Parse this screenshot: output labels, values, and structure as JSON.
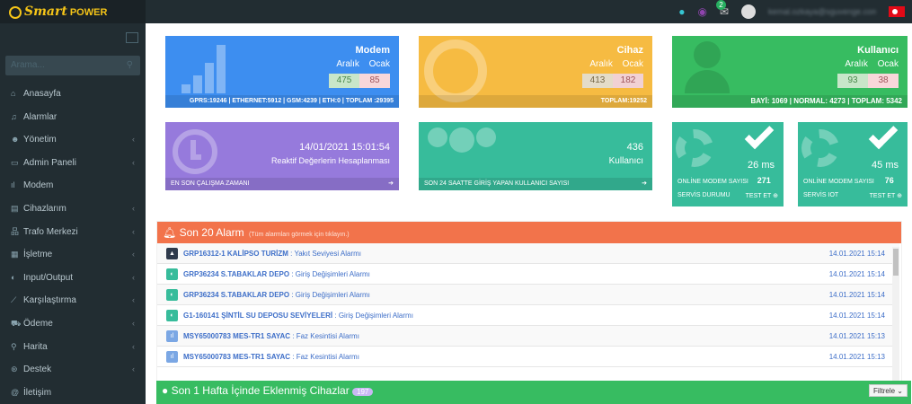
{
  "app": {
    "logo_main": "Smart",
    "logo_sub": "POWER"
  },
  "topbar": {
    "notif_count": "2",
    "user_email": "kemal.ozkaya@sguvenge.com"
  },
  "sidebar": {
    "search_placeholder": "Arama...",
    "items": [
      {
        "label": "Anasayfa",
        "icon": "home-icon",
        "has_children": false
      },
      {
        "label": "Alarmlar",
        "icon": "bell-icon",
        "has_children": false
      },
      {
        "label": "Yönetim",
        "icon": "users-icon",
        "has_children": true
      },
      {
        "label": "Admin Paneli",
        "icon": "monitor-icon",
        "has_children": true
      },
      {
        "label": "Modem",
        "icon": "signal-icon",
        "has_children": false
      },
      {
        "label": "Cihazlarım",
        "icon": "device-icon",
        "has_children": true
      },
      {
        "label": "Trafo Merkezi",
        "icon": "sitemap-icon",
        "has_children": true
      },
      {
        "label": "İşletme",
        "icon": "building-icon",
        "has_children": true
      },
      {
        "label": "Input/Output",
        "icon": "toggle-icon",
        "has_children": true
      },
      {
        "label": "Karşılaştırma",
        "icon": "chart-icon",
        "has_children": true
      },
      {
        "label": "Ödeme",
        "icon": "cart-icon",
        "has_children": true
      },
      {
        "label": "Harita",
        "icon": "map-pin-icon",
        "has_children": true
      },
      {
        "label": "Destek",
        "icon": "support-icon",
        "has_children": true
      },
      {
        "label": "İletişim",
        "icon": "contact-icon",
        "has_children": false
      }
    ]
  },
  "cards": {
    "modem": {
      "title": "Modem",
      "sub_a": "Aralık",
      "sub_b": "Ocak",
      "val_a": "475",
      "val_b": "85",
      "footer": "GPRS:19246 | ETHERNET:5912 | GSM:4239 | ETH:0 | TOPLAM :29395"
    },
    "cihaz": {
      "title": "Cihaz",
      "sub_a": "Aralık",
      "sub_b": "Ocak",
      "val_a": "413",
      "val_b": "182",
      "footer": "TOPLAM:19252"
    },
    "kullanici": {
      "title": "Kullanıcı",
      "sub_a": "Aralık",
      "sub_b": "Ocak",
      "val_a": "93",
      "val_b": "38",
      "footer": "BAYİ: 1069 | NORMAL: 4273 | TOPLAM: 5342"
    },
    "last_run": {
      "datetime": "14/01/2021 15:01:54",
      "desc": "Reaktif Değerlerin Hesaplanması",
      "footer": "EN SON ÇALIŞMA ZAMANI"
    },
    "users24": {
      "count": "436",
      "label": "Kullanıcı",
      "footer": "SON 24 SAATTE GİRİŞ YAPAN KULLANICI SAYISI"
    },
    "service1": {
      "ms": "26 ms",
      "online_label": "ONLİNE MODEM SAYISI",
      "online_val": "271",
      "footer_left": "SERVİS DURUMU",
      "footer_right": "TEST ET"
    },
    "service2": {
      "ms": "45 ms",
      "online_label": "ONLİNE MODEM SAYISI",
      "online_val": "76",
      "footer_left": "SERVİS IOT",
      "footer_right": "TEST ET"
    }
  },
  "alarms": {
    "title": "Son 20 Alarm",
    "hint": "(Tüm alarmları görmek için tıklayın.)",
    "rows": [
      {
        "icon": "flask-icon",
        "device": "GRP16312-1 KALİPSO TURİZM",
        "desc": "Yakıt Seviyesi Alarmı",
        "time": "14.01.2021 15:14"
      },
      {
        "icon": "toggle-icon",
        "device": "GRP36234 S.TABAKLAR DEPO",
        "desc": "Giriş Değişimleri Alarmı",
        "time": "14.01.2021 15:14"
      },
      {
        "icon": "toggle-icon",
        "device": "GRP36234 S.TABAKLAR DEPO",
        "desc": "Giriş Değişimleri Alarmı",
        "time": "14.01.2021 15:14"
      },
      {
        "icon": "toggle-icon",
        "device": "G1-160141 ŞİNTİL SU DEPOSU SEVİYELERİ",
        "desc": "Giriş Değişimleri Alarmı",
        "time": "14.01.2021 15:14"
      },
      {
        "icon": "meter-icon",
        "device": "MSY65000783 MES-TR1 SAYAC",
        "desc": "Faz Kesintisi Alarmı",
        "time": "14.01.2021 15:13"
      },
      {
        "icon": "meter-icon",
        "device": "MSY65000783 MES-TR1 SAYAC",
        "desc": "Faz Kesintisi Alarmı",
        "time": "14.01.2021 15:13"
      }
    ]
  },
  "weekly": {
    "title": "Son 1 Hafta İçinde Eklenmiş Cihazlar",
    "count": "197",
    "filter_label": "Filtrele"
  }
}
